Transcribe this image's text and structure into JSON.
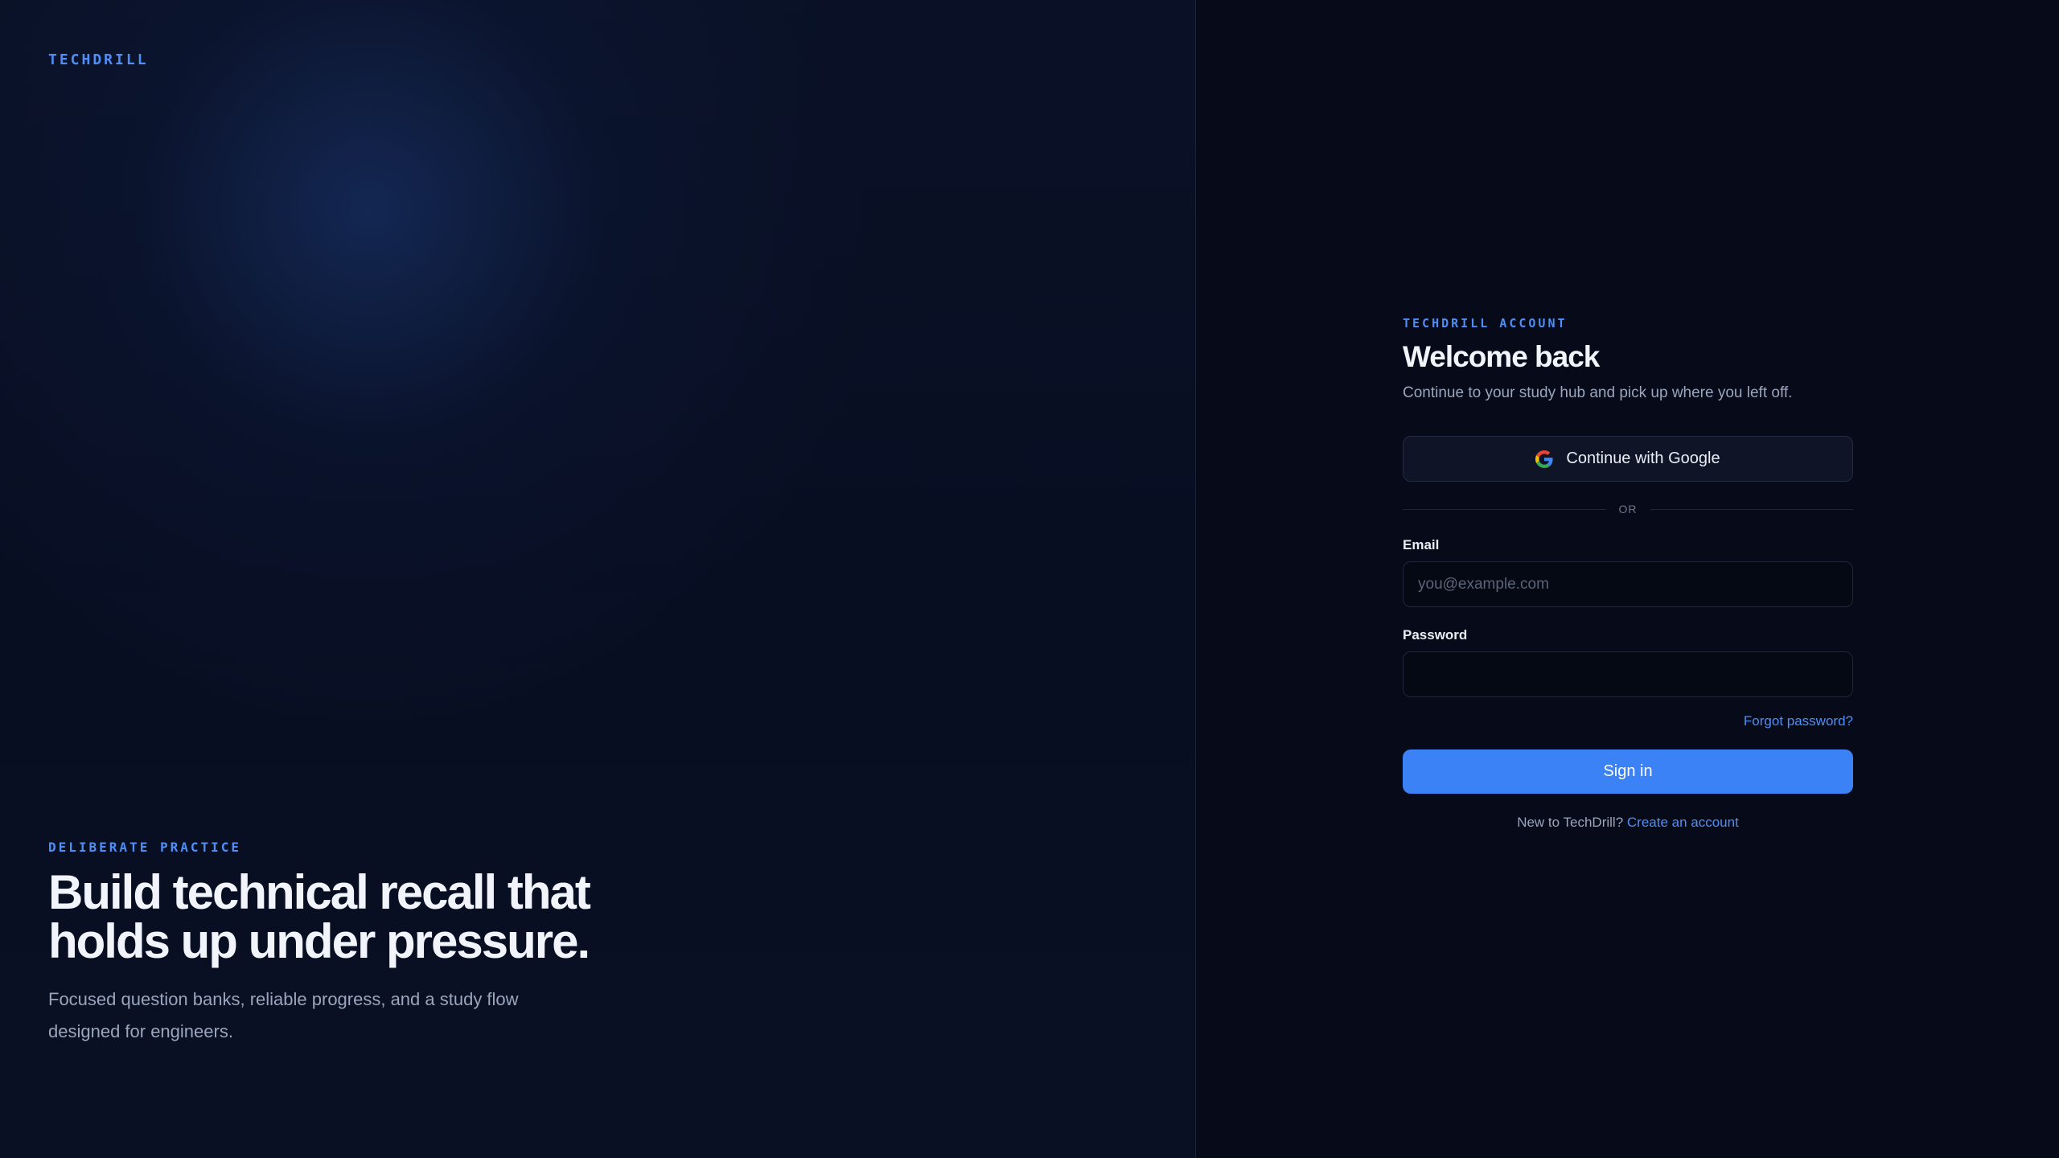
{
  "hero": {
    "brand": "TECHDRILL",
    "eyebrow": "DELIBERATE PRACTICE",
    "title": "Build technical recall that holds up under pressure.",
    "subtitle": "Focused question banks, reliable progress, and a study flow designed for engineers."
  },
  "auth": {
    "eyebrow": "TECHDRILL ACCOUNT",
    "title": "Welcome back",
    "subtitle": "Continue to your study hub and pick up where you left off.",
    "google_button": {
      "label": "Continue with Google",
      "icon": "google-icon"
    },
    "divider": "OR",
    "email": {
      "label": "Email",
      "placeholder": "you@example.com",
      "value": ""
    },
    "password": {
      "label": "Password",
      "placeholder": "",
      "value": ""
    },
    "forgot_link": "Forgot password?",
    "signin_button": "Sign in",
    "signup_prompt": "New to TechDrill?",
    "signup_link": "Create an account"
  },
  "colors": {
    "accent": "#3b82f6",
    "link": "#4f8ff5",
    "background": "#060a18"
  }
}
